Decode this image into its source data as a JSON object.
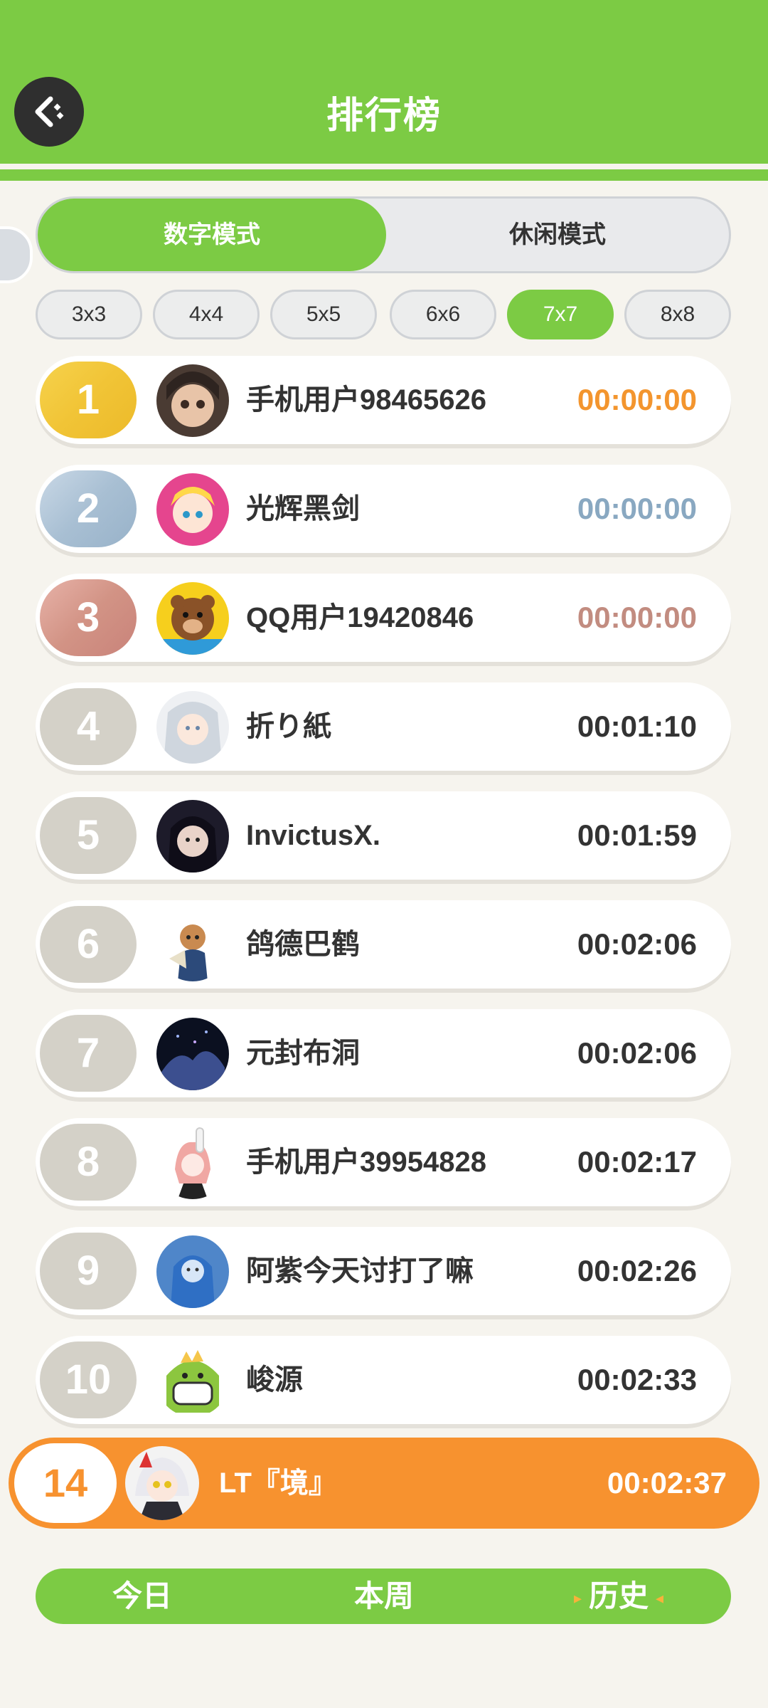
{
  "header": {
    "title": "排行榜"
  },
  "modes": [
    {
      "label": "数字模式",
      "active": true
    },
    {
      "label": "休闲模式",
      "active": false
    }
  ],
  "sizes": [
    {
      "label": "3x3",
      "active": false
    },
    {
      "label": "4x4",
      "active": false
    },
    {
      "label": "5x5",
      "active": false
    },
    {
      "label": "6x6",
      "active": false
    },
    {
      "label": "7x7",
      "active": true
    },
    {
      "label": "8x8",
      "active": false
    }
  ],
  "leaderboard": [
    {
      "rank": "1",
      "name": "手机用户98465626",
      "time": "00:00:00"
    },
    {
      "rank": "2",
      "name": "光辉黑剑",
      "time": "00:00:00"
    },
    {
      "rank": "3",
      "name": "QQ用户19420846",
      "time": "00:00:00"
    },
    {
      "rank": "4",
      "name": "折り紙",
      "time": "00:01:10"
    },
    {
      "rank": "5",
      "name": "InvictusX.",
      "time": "00:01:59"
    },
    {
      "rank": "6",
      "name": "鸽德巴鹤",
      "time": "00:02:06"
    },
    {
      "rank": "7",
      "name": "元封布洞",
      "time": "00:02:06"
    },
    {
      "rank": "8",
      "name": "手机用户39954828",
      "time": "00:02:17"
    },
    {
      "rank": "9",
      "name": "阿紫今天讨打了嘛",
      "time": "00:02:26"
    },
    {
      "rank": "10",
      "name": "峻源",
      "time": "00:02:33"
    }
  ],
  "my_entry": {
    "rank": "14",
    "name": "LT『境』",
    "time": "00:02:37"
  },
  "periods": [
    {
      "label": "今日",
      "active": false
    },
    {
      "label": "本周",
      "active": false
    },
    {
      "label": "历史",
      "active": true
    }
  ],
  "colors": {
    "primary_green": "#7ccb44",
    "accent_orange": "#f7922f",
    "gold": "#f1c436",
    "silver": "#a8bfd3",
    "bronze": "#d29385"
  },
  "icons": {
    "back": "back-arrow-icon"
  }
}
